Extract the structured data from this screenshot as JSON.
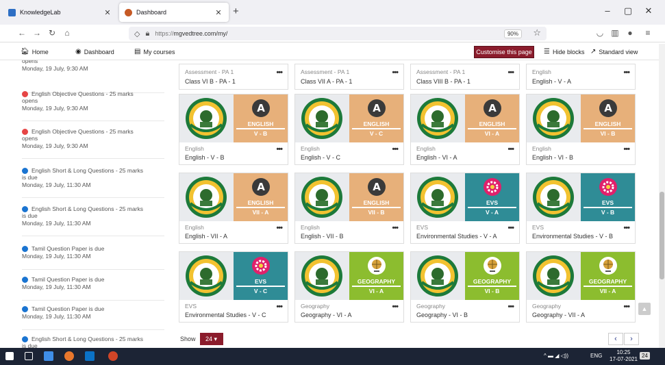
{
  "browser": {
    "tabs": [
      {
        "label": "KnowledgeLab"
      },
      {
        "label": "Dashboard"
      }
    ],
    "url_prefix": "https://",
    "url_main": "mgvedtree.com/my/",
    "zoom": "90%"
  },
  "site": {
    "nav": [
      {
        "label": "Home"
      },
      {
        "label": "Dashboard"
      },
      {
        "label": "My courses"
      }
    ],
    "customise": "Customise this page",
    "hide_blocks": "Hide blocks",
    "standard_view": "Standard view"
  },
  "events": [
    {
      "title": "",
      "sub": "opens",
      "time": "Monday, 19 July, 9:30 AM",
      "color": "#e64545"
    },
    {
      "title": "English Objective Questions - 25 marks",
      "sub": "opens",
      "time": "Monday, 19 July, 9:30 AM",
      "color": "#e64545"
    },
    {
      "title": "English Objective Questions - 25 marks",
      "sub": "opens",
      "time": "Monday, 19 July, 9:30 AM",
      "color": "#e64545"
    },
    {
      "title": "English Short & Long Questions - 25 marks",
      "sub": "is due",
      "time": "Monday, 19 July, 11:30 AM",
      "color": "#1a74d1"
    },
    {
      "title": "English Short & Long Questions - 25 marks",
      "sub": "is due",
      "time": "Monday, 19 July, 11:30 AM",
      "color": "#1a74d1"
    },
    {
      "title": "Tamil Question Paper is due",
      "sub": "",
      "time": "Monday, 19 July, 11:30 AM",
      "color": "#1a74d1"
    },
    {
      "title": "Tamil Question Paper is due",
      "sub": "",
      "time": "Monday, 19 July, 11:30 AM",
      "color": "#1a74d1"
    },
    {
      "title": "Tamil Question Paper is due",
      "sub": "",
      "time": "Monday, 19 July, 11:30 AM",
      "color": "#1a74d1"
    },
    {
      "title": "English Short & Long Questions - 25 marks",
      "sub": "is due",
      "time": "",
      "color": "#1a74d1"
    }
  ],
  "top_courses": [
    {
      "cat": "Assessment - PA 1",
      "name": "Class VI B - PA - 1"
    },
    {
      "cat": "Assessment - PA 1",
      "name": "Class VII A - PA - 1"
    },
    {
      "cat": "Assessment - PA 1",
      "name": "Class VIII B - PA - 1"
    },
    {
      "cat": "English",
      "name": "English - V - A"
    }
  ],
  "courses": [
    {
      "cat": "English",
      "name": "English - V - B",
      "subject": "ENGLISH",
      "cls": "V - B",
      "bg": "#e7b07a",
      "icon": "english-a-icon"
    },
    {
      "cat": "English",
      "name": "English - V - C",
      "subject": "ENGLISH",
      "cls": "V - C",
      "bg": "#e7b07a",
      "icon": "english-a-icon"
    },
    {
      "cat": "English",
      "name": "English - VI - A",
      "subject": "ENGLISH",
      "cls": "VI - A",
      "bg": "#e7b07a",
      "icon": "english-a-icon"
    },
    {
      "cat": "English",
      "name": "English - VI - B",
      "subject": "ENGLISH",
      "cls": "VI - B",
      "bg": "#e7b07a",
      "icon": "english-a-icon"
    },
    {
      "cat": "English",
      "name": "English - VII - A",
      "subject": "ENGLISH",
      "cls": "VII - A",
      "bg": "#e7b07a",
      "icon": "english-a-icon"
    },
    {
      "cat": "English",
      "name": "English - VII - B",
      "subject": "ENGLISH",
      "cls": "VII - B",
      "bg": "#e7b07a",
      "icon": "english-a-icon"
    },
    {
      "cat": "EVS",
      "name": "Environmental Studies - V - A",
      "subject": "EVS",
      "cls": "V - A",
      "bg": "#2f8c96",
      "icon": "evs-gear-icon"
    },
    {
      "cat": "EVS",
      "name": "Environmental Studies - V - B",
      "subject": "EVS",
      "cls": "V - B",
      "bg": "#2f8c96",
      "icon": "evs-gear-icon"
    },
    {
      "cat": "EVS",
      "name": "Environmental Studies - V - C",
      "subject": "EVS",
      "cls": "V - C",
      "bg": "#2f8c96",
      "icon": "evs-gear-icon"
    },
    {
      "cat": "Geography",
      "name": "Geography - VI - A",
      "subject": "GEOGRAPHY",
      "cls": "VI - A",
      "bg": "#8cbd2f",
      "icon": "globe-icon"
    },
    {
      "cat": "Geography",
      "name": "Geography - VI - B",
      "subject": "GEOGRAPHY",
      "cls": "VI - B",
      "bg": "#8cbd2f",
      "icon": "globe-icon"
    },
    {
      "cat": "Geography",
      "name": "Geography - VII - A",
      "subject": "GEOGRAPHY",
      "cls": "VII - A",
      "bg": "#8cbd2f",
      "icon": "globe-icon"
    }
  ],
  "paging": {
    "show_label": "Show",
    "per_page": "24 ▾",
    "prev": "‹",
    "next": "›"
  },
  "taskbar": {
    "lang": "ENG",
    "time": "10:25",
    "date": "17-07-2021",
    "badge": "24"
  },
  "colors": {
    "accent": "#8b1c2c",
    "link": "#2b3b8a"
  }
}
